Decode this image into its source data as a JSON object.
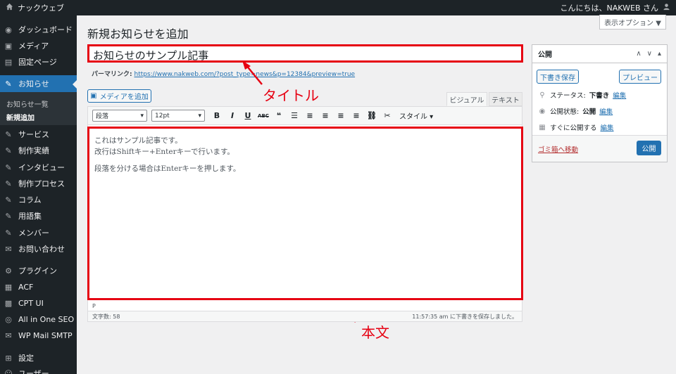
{
  "adminbar": {
    "site_name": "ナックウェブ",
    "greeting": "こんにちは、NAKWEB さん"
  },
  "sidebar": {
    "items": [
      {
        "label": "ダッシュボード",
        "icon": "dashboard-icon"
      },
      {
        "label": "メディア",
        "icon": "media-icon"
      },
      {
        "label": "固定ページ",
        "icon": "page-icon"
      },
      {
        "label": "お知らせ",
        "icon": "pin-icon"
      },
      {
        "label": "サービス",
        "icon": "pin-icon"
      },
      {
        "label": "制作実績",
        "icon": "pin-icon"
      },
      {
        "label": "インタビュー",
        "icon": "pin-icon"
      },
      {
        "label": "制作プロセス",
        "icon": "pin-icon"
      },
      {
        "label": "コラム",
        "icon": "pin-icon"
      },
      {
        "label": "用語集",
        "icon": "pin-icon"
      },
      {
        "label": "メンバー",
        "icon": "pin-icon"
      },
      {
        "label": "お問い合わせ",
        "icon": "mail-icon"
      },
      {
        "label": "プラグイン",
        "icon": "plugin-icon"
      },
      {
        "label": "ACF",
        "icon": "acf-icon"
      },
      {
        "label": "CPT UI",
        "icon": "cpt-icon"
      },
      {
        "label": "All in One SEO",
        "icon": "seo-icon"
      },
      {
        "label": "WP Mail SMTP",
        "icon": "mail-smtp-icon"
      },
      {
        "label": "設定",
        "icon": "settings-icon"
      },
      {
        "label": "ユーザー",
        "icon": "user-icon"
      }
    ],
    "submenu": [
      "お知らせ一覧",
      "新規追加"
    ]
  },
  "page": {
    "title": "新規お知らせを追加",
    "screen_options": "表示オプション ▼"
  },
  "post": {
    "title": "お知らせのサンプル記事",
    "permalink_label": "パーマリンク:",
    "permalink_url": "https://www.nakweb.com/?post_type=news&p=12384&preview=true",
    "add_media": "メディアを追加",
    "tab_visual": "ビジュアル",
    "tab_text": "テキスト",
    "format_select": "段落",
    "size_select": "12pt",
    "style_label": "スタイル ▾",
    "body_lines": [
      "これはサンプル記事です。",
      "改行はShiftキー+Enterキーで行います。",
      "段落を分ける場合はEnterキーを押します。"
    ],
    "path": "P",
    "word_count": "文字数: 58",
    "save_status": "11:57:35 am に下書きを保存しました。"
  },
  "annotations": {
    "title": "タイトル",
    "body": "本文"
  },
  "publish": {
    "heading": "公開",
    "save_draft": "下書き保存",
    "preview": "プレビュー",
    "status_label": "ステータス:",
    "status_value": "下書き",
    "visibility_label": "公開状態:",
    "visibility_value": "公開",
    "schedule_label": "すぐに公開する",
    "edit": "編集",
    "trash": "ゴミ箱へ移動",
    "publish_button": "公開"
  },
  "colors": {
    "accent": "#2271b1",
    "highlight": "#e60012",
    "sidebar": "#1d2327"
  }
}
